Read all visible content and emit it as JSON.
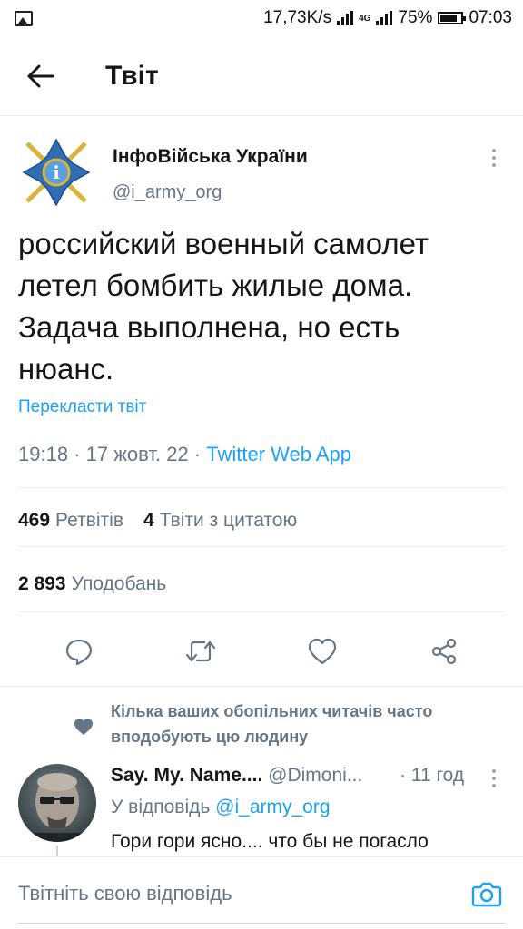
{
  "status_bar": {
    "speed": "17,73K/s",
    "network": "4G",
    "battery": "75%",
    "time": "07:03"
  },
  "header": {
    "title": "Твіт"
  },
  "tweet": {
    "author_name": "ІнфоВійська України",
    "author_handle": "@i_army_org",
    "text": "российский военный самолет летел бомбить жилые дома. Задача выполнена, но есть нюанс.",
    "translate_label": "Перекласти твіт",
    "time_date": "19:18 · 17 жовт. 22 · ",
    "source_app": "Twitter Web App",
    "retweets_count": "469",
    "retweets_label": "Ретвітів",
    "quotes_count": "4",
    "quotes_label": "Твіти з цитатою",
    "likes_count": "2 893",
    "likes_label": "Уподобань"
  },
  "reply": {
    "social_context": "Кілька ваших обопільних читачів часто вподобують цю людину",
    "name": "Say. My. Name....",
    "handle": "@Dimoni...",
    "time": "· 11 год",
    "replying_to_prefix": "У відповідь ",
    "replying_to_handle": "@i_army_org",
    "text": "Гори гори ясно.... что бы не погасло"
  },
  "compose": {
    "placeholder": "Твітніть свою відповідь"
  },
  "colors": {
    "accent": "#1da1f2",
    "secondary_text": "#657786",
    "primary_text": "#14171a",
    "divider": "#e6ecf0"
  },
  "icons": {
    "back": "arrow-left-icon",
    "more": "vertical-dots-icon",
    "reply": "speech-bubble-icon",
    "retweet": "retweet-icon",
    "like": "heart-icon",
    "share": "share-icon",
    "camera": "camera-icon"
  }
}
